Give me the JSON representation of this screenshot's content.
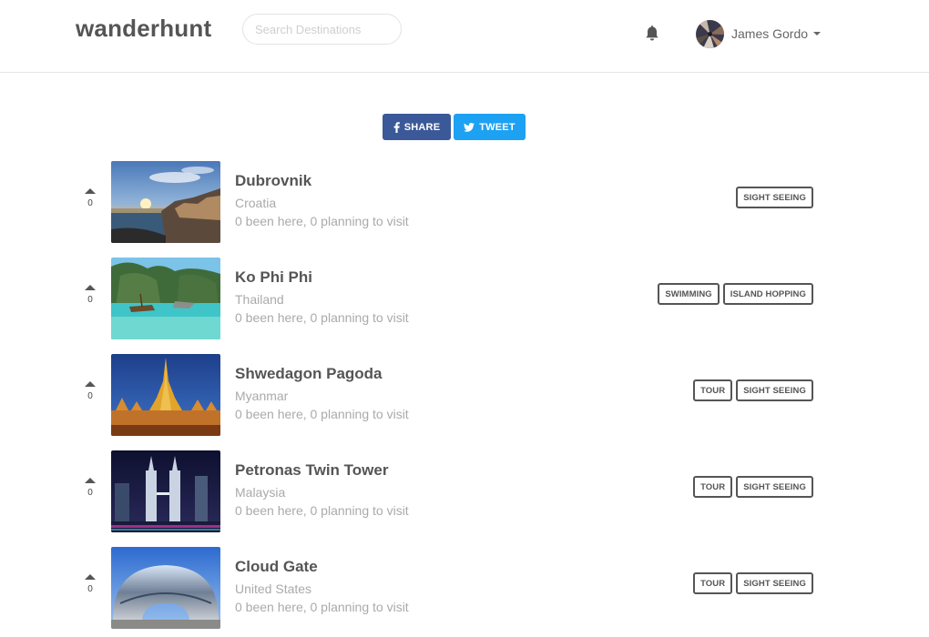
{
  "header": {
    "logo": "wanderhunt",
    "search_placeholder": "Search Destinations",
    "user_name": "James Gordo",
    "icons": {
      "notifications": "bell-icon",
      "avatar": "user-avatar",
      "menu": "caret-down-icon"
    }
  },
  "social": {
    "share_label": "SHARE",
    "tweet_label": "TWEET",
    "colors": {
      "facebook": "#3b5998",
      "twitter": "#1da1f2"
    }
  },
  "destinations": [
    {
      "name": "Dubrovnik",
      "country": "Croatia",
      "stats": "0 been here, 0 planning to visit",
      "votes": "0",
      "tags": [
        "SIGHT SEEING"
      ]
    },
    {
      "name": "Ko Phi Phi",
      "country": "Thailand",
      "stats": "0 been here, 0 planning to visit",
      "votes": "0",
      "tags": [
        "SWIMMING",
        "ISLAND HOPPING"
      ]
    },
    {
      "name": "Shwedagon Pagoda",
      "country": "Myanmar",
      "stats": "0 been here, 0 planning to visit",
      "votes": "0",
      "tags": [
        "TOUR",
        "SIGHT SEEING"
      ]
    },
    {
      "name": "Petronas Twin Tower",
      "country": "Malaysia",
      "stats": "0 been here, 0 planning to visit",
      "votes": "0",
      "tags": [
        "TOUR",
        "SIGHT SEEING"
      ]
    },
    {
      "name": "Cloud Gate",
      "country": "United States",
      "stats": "0 been here, 0 planning to visit",
      "votes": "0",
      "tags": [
        "TOUR",
        "SIGHT SEEING"
      ]
    }
  ]
}
